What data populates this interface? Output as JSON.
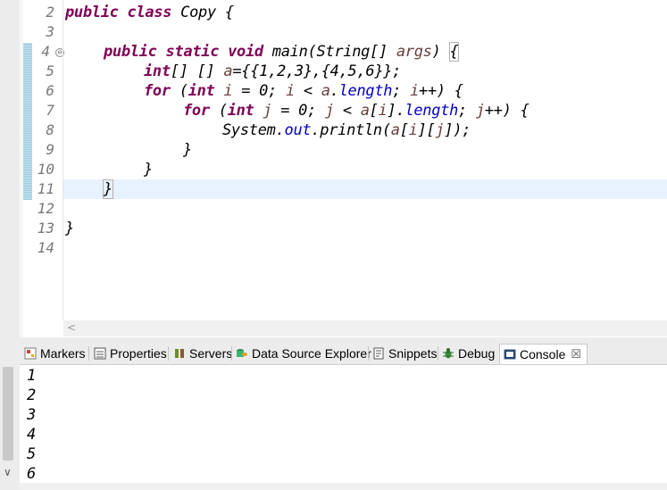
{
  "editor": {
    "line_numbers": [
      "2",
      "3",
      "4",
      "5",
      "6",
      "7",
      "8",
      "9",
      "10",
      "11",
      "12",
      "13",
      "14"
    ],
    "fold_marker": "⊖",
    "code": {
      "l2": {
        "kw1": "public",
        "kw2": "class",
        "name": "Copy {"
      },
      "l4": {
        "kw1": "public",
        "kw2": "static",
        "kw3": "void",
        "rest1": "main(String[] ",
        "param": "args",
        "rest2": ") ",
        "brace": "{"
      },
      "l5": {
        "kw": "int",
        "rest1": "[] [] ",
        "var": "a",
        "rest2": "={{1,2,3},{4,5,6}};"
      },
      "l6": {
        "kw1": "for",
        "rest1": " (",
        "kw2": "int",
        "var1": " i",
        "rest2": " = 0; ",
        "var2": "i",
        "rest3": " < ",
        "var3": "a",
        "rest4": ".",
        "fld": "length",
        "rest5": "; ",
        "var4": "i",
        "rest6": "++) {"
      },
      "l7": {
        "kw1": "for",
        "rest1": " (",
        "kw2": "int",
        "var1": " j",
        "rest2": " = 0; ",
        "var2": "j",
        "rest3": " < ",
        "var3": "a",
        "rest4": "[",
        "var4": "i",
        "rest5": "].",
        "fld": "length",
        "rest6": "; ",
        "var5": "j",
        "rest7": "++) {"
      },
      "l8": {
        "rest1": "System.",
        "fld": "out",
        "rest2": ".println(",
        "var1": "a",
        "rest3": "[",
        "var2": "i",
        "rest4": "][",
        "var3": "j",
        "rest5": "]);"
      },
      "l9": {
        "text": "}"
      },
      "l10": {
        "text": "}"
      },
      "l11": {
        "text": "}"
      },
      "l13": {
        "text": "}"
      }
    },
    "scroll_left_arrow": "<"
  },
  "tabs": [
    {
      "label": "Markers",
      "icon": "markers-icon"
    },
    {
      "label": "Properties",
      "icon": "properties-icon"
    },
    {
      "label": "Servers",
      "icon": "servers-icon"
    },
    {
      "label": "Data Source Explorer",
      "icon": "data-source-explorer-icon"
    },
    {
      "label": "Snippets",
      "icon": "snippets-icon"
    },
    {
      "label": "Debug",
      "icon": "debug-icon"
    },
    {
      "label": "Console",
      "icon": "console-icon",
      "active": true,
      "close": "☒"
    }
  ],
  "console": {
    "output": [
      "1",
      "2",
      "3",
      "4",
      "5",
      "6"
    ],
    "scroll_down_arrow": "∨"
  },
  "colors": {
    "keyword": "#7f0055",
    "field": "#0000c0",
    "variable": "#6a3e3e",
    "current_line": "#e8f2fe",
    "change_ruler": "#9ccbe0"
  }
}
